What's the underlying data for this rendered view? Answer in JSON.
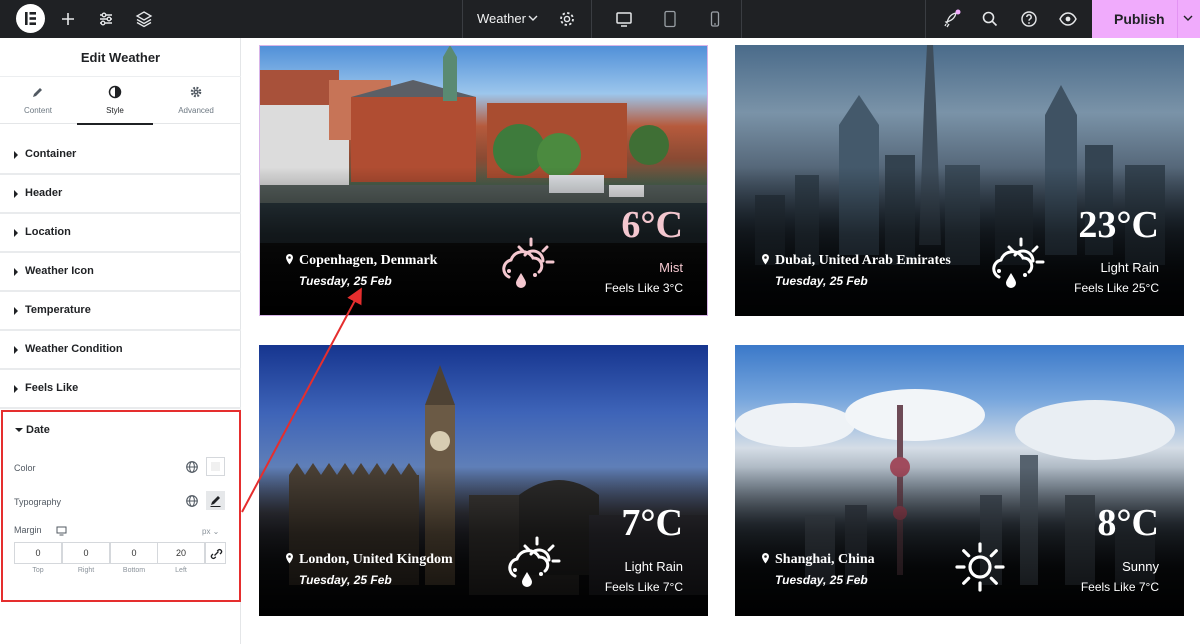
{
  "topbar": {
    "page_title": "Weather",
    "publish_label": "Publish"
  },
  "sidebar": {
    "title": "Edit Weather",
    "tabs": [
      {
        "label": "Content"
      },
      {
        "label": "Style"
      },
      {
        "label": "Advanced"
      }
    ],
    "active_tab": "Style",
    "sections": [
      {
        "label": "Container"
      },
      {
        "label": "Header"
      },
      {
        "label": "Location"
      },
      {
        "label": "Weather Icon"
      },
      {
        "label": "Temperature"
      },
      {
        "label": "Weather Condition"
      },
      {
        "label": "Feels Like"
      }
    ],
    "date_section": {
      "label": "Date",
      "color_label": "Color",
      "typography_label": "Typography",
      "margin_label": "Margin",
      "unit": "px",
      "margin": {
        "top": "0",
        "right": "0",
        "bottom": "0",
        "left": "20"
      },
      "captions": {
        "top": "Top",
        "right": "Right",
        "bottom": "Bottom",
        "left": "Left"
      }
    }
  },
  "cards": [
    {
      "location": "Copenhagen, Denmark",
      "date": "Tuesday, 25 Feb",
      "temperature": "6°C",
      "condition": "Mist",
      "feels_like": "Feels Like 3°C",
      "icon": "cloud-rain-sun-icon",
      "accent": "#f4c7cf"
    },
    {
      "location": "Dubai, United Arab Emirates",
      "date": "Tuesday, 25 Feb",
      "temperature": "23°C",
      "condition": "Light Rain",
      "feels_like": "Feels Like 25°C",
      "icon": "cloud-rain-sun-icon",
      "accent": "#ffffff"
    },
    {
      "location": "London, United Kingdom",
      "date": "Tuesday, 25 Feb",
      "temperature": "7°C",
      "condition": "Light Rain",
      "feels_like": "Feels Like 7°C",
      "icon": "cloud-rain-sun-icon",
      "accent": "#ffffff"
    },
    {
      "location": "Shanghai, China",
      "date": "Tuesday, 25 Feb",
      "temperature": "8°C",
      "condition": "Sunny",
      "feels_like": "Feels Like 7°C",
      "icon": "sun-icon",
      "accent": "#ffffff"
    }
  ],
  "colors": {
    "topbar": "#1f2124",
    "publish": "#f0abfc",
    "highlight": "#e52e2e"
  }
}
